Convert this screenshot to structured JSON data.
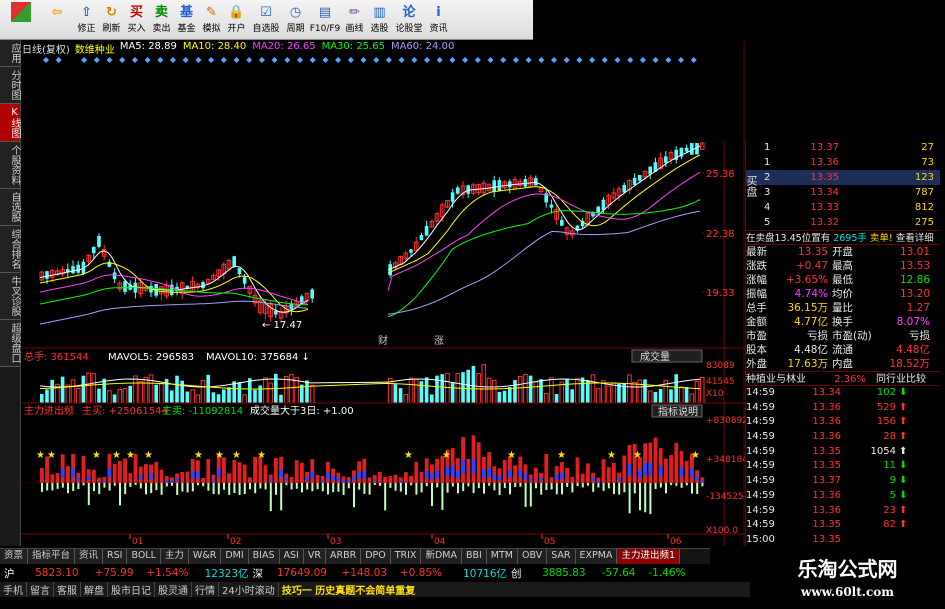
{
  "toolbar": {
    "buttons": [
      {
        "label": "",
        "icon": "grid-icon"
      },
      {
        "label": "",
        "icon": "back-arrow-icon"
      },
      {
        "label": "修正",
        "icon": "fix-icon"
      },
      {
        "label": "刷新",
        "icon": "refresh-icon"
      },
      {
        "label": "买入",
        "icon": "buy-icon"
      },
      {
        "label": "卖出",
        "icon": "sell-icon"
      },
      {
        "label": "基金",
        "icon": "fund-icon"
      },
      {
        "label": "模拟",
        "icon": "simulate-icon"
      },
      {
        "label": "开户",
        "icon": "lock-icon"
      },
      {
        "label": "自选股",
        "icon": "watchlist-icon"
      },
      {
        "label": "周期",
        "icon": "period-icon"
      },
      {
        "label": "F10/F9",
        "icon": "f10-icon"
      },
      {
        "label": "画线",
        "icon": "draw-line-icon"
      },
      {
        "label": "选股",
        "icon": "stock-pick-icon"
      },
      {
        "label": "论股堂",
        "icon": "forum-icon"
      },
      {
        "label": "资讯",
        "icon": "news-icon"
      }
    ]
  },
  "left_tabs": [
    "应用",
    "分时图",
    "K线图",
    "个股资料",
    "自选股",
    "综合排名",
    "牛叉诊股",
    "超级盘口"
  ],
  "kline_header": {
    "mode": "日线(复权)",
    "name": "数维种业",
    "ma": [
      {
        "label": "MA5: 28.89",
        "color": "#ffffff"
      },
      {
        "label": "MA10: 28.40",
        "color": "#ffff00"
      },
      {
        "label": "MA20: 26.65",
        "color": "#ff40ff"
      },
      {
        "label": "MA30: 25.65",
        "color": "#00ff00"
      },
      {
        "label": "MA60: 24.00",
        "color": "#a0a0ff"
      }
    ]
  },
  "price_axis": [
    "25.38",
    "22.38",
    "19.33"
  ],
  "low_label": "17.47",
  "center_labels": [
    "财",
    "涨"
  ],
  "volume_header": {
    "total": "总手: 361544",
    "mavol5": "MAVOL5: 296583",
    "mavol10": "MAVOL10: 375684",
    "panel": "成交量"
  },
  "volume_axis": [
    "83089",
    "41545",
    "X10"
  ],
  "flow_header": {
    "title": "主力进出频",
    "main": "主买: +25061544",
    "sell": "主卖: -11092814",
    "big": "成交量大于3日: +1.00",
    "panel": "指标说明"
  },
  "flow_axis": [
    "+830892",
    "+348184",
    "-134525",
    "X100.0"
  ],
  "date_axis": [
    "01",
    "02",
    "03",
    "04",
    "05",
    "06"
  ],
  "right_panel": {
    "buy_label": "买盘",
    "orders": [
      {
        "lvl": "1",
        "price": "13.37",
        "vol": "27"
      },
      {
        "lvl": "1",
        "price": "13.36",
        "vol": "73"
      },
      {
        "lvl": "2",
        "price": "13.35",
        "vol": "123"
      },
      {
        "lvl": "3",
        "price": "13.34",
        "vol": "787"
      },
      {
        "lvl": "4",
        "price": "13.33",
        "vol": "812"
      },
      {
        "lvl": "5",
        "price": "13.32",
        "vol": "275"
      }
    ],
    "sell_notice": "在卖盘13.45位置有",
    "sell_notice_vol": "2695手",
    "sell_notice_tag": "卖单!",
    "sell_notice_link": "查看详细",
    "stats": [
      {
        "k1": "最新",
        "v1": "13.35",
        "k2": "开盘",
        "v2": "13.01"
      },
      {
        "k1": "涨跌",
        "v1": "+0.47",
        "k2": "最高",
        "v2": "13.53"
      },
      {
        "k1": "涨幅",
        "v1": "+3.65%",
        "k2": "最低",
        "v2": "12.86"
      },
      {
        "k1": "振幅",
        "v1": "4.74%",
        "k2": "均价",
        "v2": "13.20"
      },
      {
        "k1": "总手",
        "v1": "36.15万",
        "k2": "量比",
        "v2": "1.27"
      },
      {
        "k1": "金额",
        "v1": "4.77亿",
        "k2": "换手",
        "v2": "8.07%"
      },
      {
        "k1": "市盈",
        "v1": "亏损",
        "k2": "市盈(动)",
        "v2": "亏损"
      },
      {
        "k1": "股本",
        "v1": "4.48亿",
        "k2": "流通",
        "v2": "4.48亿"
      },
      {
        "k1": "外盘",
        "v1": "17.63万",
        "k2": "内盘",
        "v2": "18.52万"
      }
    ],
    "industry": "种植业与林业",
    "industry_pct": "2.36%",
    "industry_btn": "同行业比较",
    "ticks": [
      {
        "t": "14:59",
        "p": "13.34",
        "v": "102",
        "d": "down"
      },
      {
        "t": "14:59",
        "p": "13.36",
        "v": "529",
        "d": "up"
      },
      {
        "t": "14:59",
        "p": "13.36",
        "v": "156",
        "d": "up"
      },
      {
        "t": "14:59",
        "p": "13.36",
        "v": "28",
        "d": "up"
      },
      {
        "t": "14:59",
        "p": "13.35",
        "v": "1054",
        "d": "none"
      },
      {
        "t": "14:59",
        "p": "13.35",
        "v": "11",
        "d": "down"
      },
      {
        "t": "14:59",
        "p": "13.37",
        "v": "9",
        "d": "down"
      },
      {
        "t": "14:59",
        "p": "13.36",
        "v": "5",
        "d": "down"
      },
      {
        "t": "14:59",
        "p": "13.36",
        "v": "23",
        "d": "up"
      },
      {
        "t": "14:59",
        "p": "13.35",
        "v": "82",
        "d": "up"
      },
      {
        "t": "15:00",
        "p": "13.35",
        "v": "",
        "d": "none"
      }
    ]
  },
  "bottom_tabs": [
    "资票",
    "指标平台",
    "资讯",
    "RSI",
    "BOLL",
    "主力",
    "W&R",
    "DMI",
    "BIAS",
    "ASI",
    "VR",
    "ARBR",
    "DPO",
    "TRIX",
    "新DMA",
    "BBI",
    "MTM",
    "OBV",
    "SAR",
    "EXPMA",
    "主力进出频1"
  ],
  "index_bar": {
    "sh": "沪",
    "sh_val": "5823.10",
    "sh_chg": "+75.99",
    "sh_pct": "+1.54%",
    "sh_amt": "12323亿",
    "sz": "深",
    "sz_val": "17649.09",
    "sz_chg": "+148.03",
    "sz_pct": "+0.85%",
    "sz_amt": "10716亿",
    "cy": "创",
    "cy_val": "3885.83",
    "cy_chg": "-57.64",
    "cy_pct": "-1.46%"
  },
  "status_bar": [
    "手机",
    "留言",
    "客服",
    "解盘",
    "股市日记",
    "股灵通",
    "行情",
    "24小时滚动",
    "技巧一 历史真题不会简单重复"
  ],
  "watermark": {
    "line1": "乐淘公式网",
    "line2": "www.60lt.com"
  }
}
